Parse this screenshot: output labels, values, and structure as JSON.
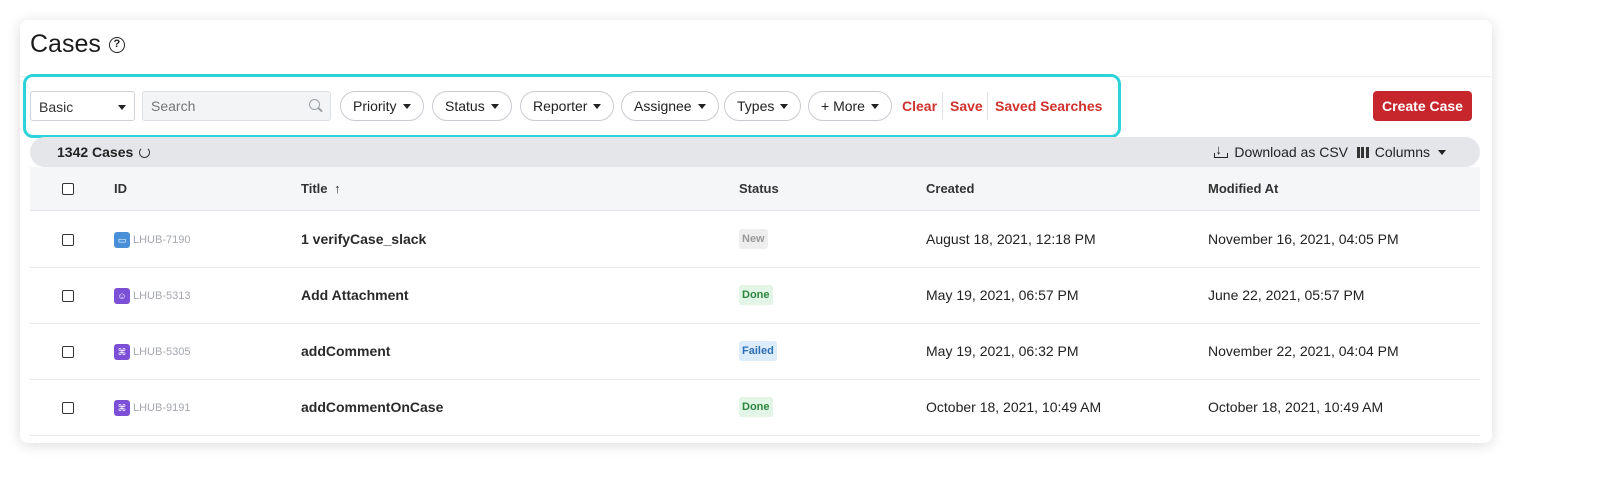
{
  "page": {
    "title": "Cases"
  },
  "filters": {
    "mode_select": "Basic",
    "search_placeholder": "Search",
    "pills": [
      "Priority",
      "Status",
      "Reporter",
      "Assignee",
      "Types",
      "+ More"
    ],
    "clear_label": "Clear",
    "save_label": "Save",
    "saved_searches_label": "Saved Searches"
  },
  "toolbar": {
    "create_label": "Create Case",
    "download_label": "Download as CSV",
    "columns_label": "Columns"
  },
  "summary": {
    "count_label": "1342 Cases"
  },
  "table": {
    "headers": {
      "id": "ID",
      "title": "Title",
      "sort_indicator": "↑",
      "status": "Status",
      "created": "Created",
      "modified": "Modified At"
    },
    "rows": [
      {
        "id": "LHUB-7190",
        "type_icon": "chat-icon",
        "title": "1 verifyCase_slack",
        "status": "New",
        "created": "August 18, 2021, 12:18 PM",
        "modified": "November 16, 2021, 04:05 PM"
      },
      {
        "id": "LHUB-5313",
        "type_icon": "user-icon",
        "title": "Add Attachment",
        "status": "Done",
        "created": "May 19, 2021, 06:57 PM",
        "modified": "June 22, 2021, 05:57 PM"
      },
      {
        "id": "LHUB-5305",
        "type_icon": "command-icon",
        "title": "addComment",
        "status": "Failed",
        "created": "May 19, 2021, 06:32 PM",
        "modified": "November 22, 2021, 04:04 PM"
      },
      {
        "id": "LHUB-9191",
        "type_icon": "command-icon",
        "title": "addCommentOnCase",
        "status": "Done",
        "created": "October 18, 2021, 10:49 AM",
        "modified": "October 18, 2021, 10:49 AM"
      }
    ]
  },
  "colors": {
    "accent_red": "#c8262d",
    "highlight_cyan": "#2ed3d7",
    "status_done_bg": "#e3f5e6",
    "status_failed_bg": "#dcecfb",
    "status_new_bg": "#eeeeee"
  }
}
